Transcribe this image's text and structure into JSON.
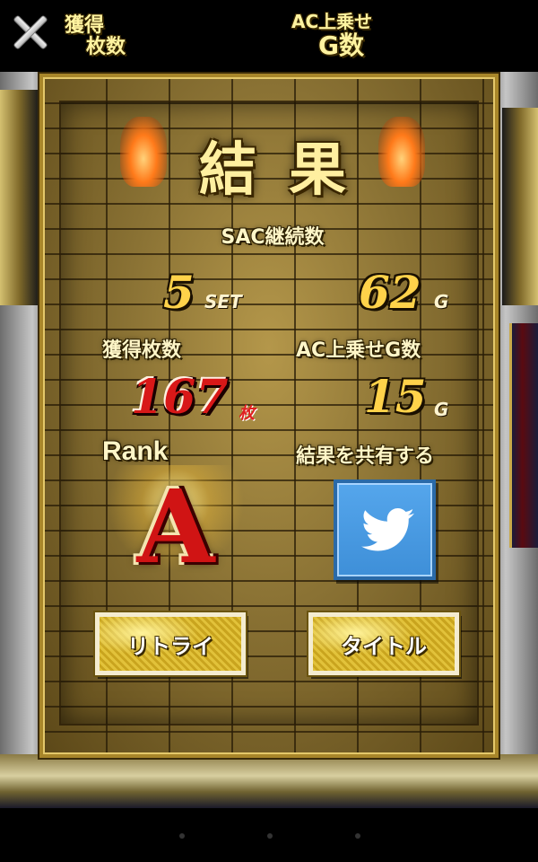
{
  "header": {
    "obtained_line1": "獲得",
    "obtained_line2": "枚数",
    "ac_line1": "AC上乗せ",
    "ac_line2": "G数"
  },
  "result": {
    "title": "結果",
    "sac_label": "SAC継続数",
    "sets_value": "5",
    "sets_unit": "SET",
    "games_value": "62",
    "games_unit": "G",
    "coins_label": "獲得枚数",
    "coins_value": "167",
    "coins_unit": "枚",
    "ac_games_label": "AC上乗せG数",
    "ac_games_value": "15",
    "ac_games_unit": "G",
    "rank_label": "Rank",
    "rank_value": "A",
    "share_label": "結果を共有する"
  },
  "buttons": {
    "retry": "リトライ",
    "title": "タイトル"
  },
  "colors": {
    "gold": "#ffd24a",
    "rank_red": "#d01414",
    "twitter_blue": "#4a9be3"
  },
  "icons": {
    "close": "close-icon",
    "share": "twitter-bird-icon"
  }
}
